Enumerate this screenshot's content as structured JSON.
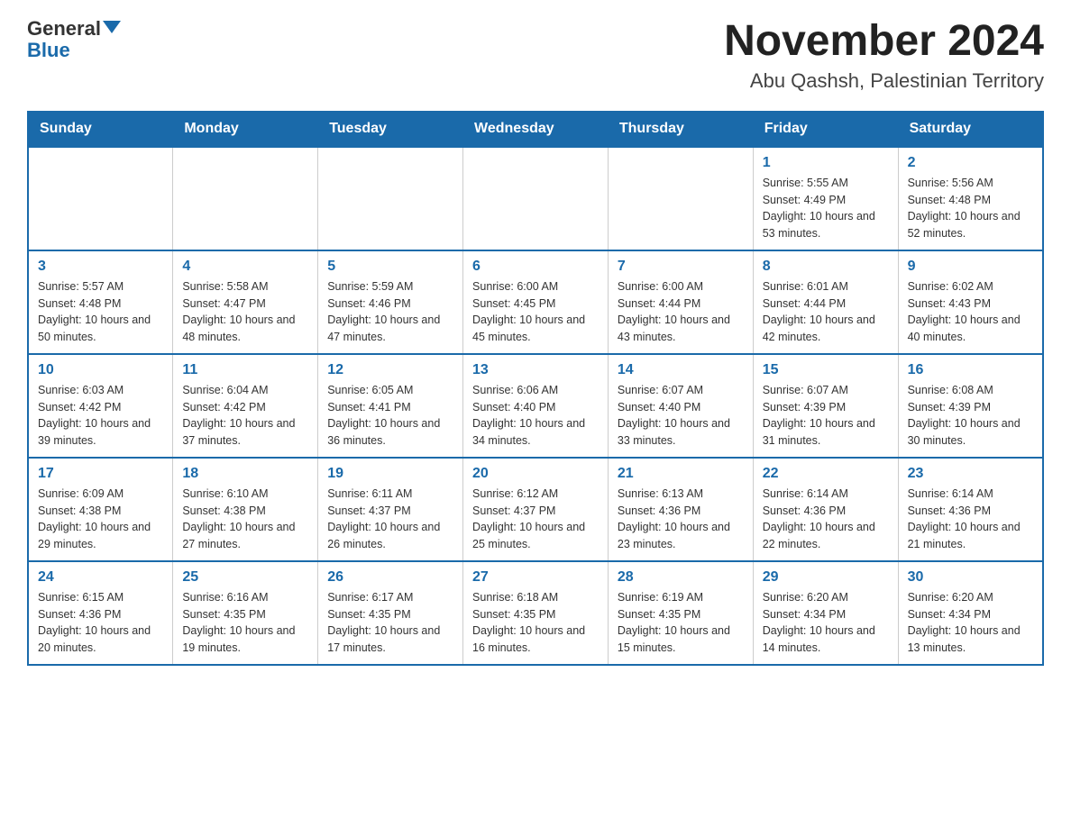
{
  "header": {
    "logo_general": "General",
    "logo_blue": "Blue",
    "title": "November 2024",
    "location": "Abu Qashsh, Palestinian Territory"
  },
  "days_of_week": [
    "Sunday",
    "Monday",
    "Tuesday",
    "Wednesday",
    "Thursday",
    "Friday",
    "Saturday"
  ],
  "weeks": [
    [
      {
        "day": "",
        "sunrise": "",
        "sunset": "",
        "daylight": ""
      },
      {
        "day": "",
        "sunrise": "",
        "sunset": "",
        "daylight": ""
      },
      {
        "day": "",
        "sunrise": "",
        "sunset": "",
        "daylight": ""
      },
      {
        "day": "",
        "sunrise": "",
        "sunset": "",
        "daylight": ""
      },
      {
        "day": "",
        "sunrise": "",
        "sunset": "",
        "daylight": ""
      },
      {
        "day": "1",
        "sunrise": "Sunrise: 5:55 AM",
        "sunset": "Sunset: 4:49 PM",
        "daylight": "Daylight: 10 hours and 53 minutes."
      },
      {
        "day": "2",
        "sunrise": "Sunrise: 5:56 AM",
        "sunset": "Sunset: 4:48 PM",
        "daylight": "Daylight: 10 hours and 52 minutes."
      }
    ],
    [
      {
        "day": "3",
        "sunrise": "Sunrise: 5:57 AM",
        "sunset": "Sunset: 4:48 PM",
        "daylight": "Daylight: 10 hours and 50 minutes."
      },
      {
        "day": "4",
        "sunrise": "Sunrise: 5:58 AM",
        "sunset": "Sunset: 4:47 PM",
        "daylight": "Daylight: 10 hours and 48 minutes."
      },
      {
        "day": "5",
        "sunrise": "Sunrise: 5:59 AM",
        "sunset": "Sunset: 4:46 PM",
        "daylight": "Daylight: 10 hours and 47 minutes."
      },
      {
        "day": "6",
        "sunrise": "Sunrise: 6:00 AM",
        "sunset": "Sunset: 4:45 PM",
        "daylight": "Daylight: 10 hours and 45 minutes."
      },
      {
        "day": "7",
        "sunrise": "Sunrise: 6:00 AM",
        "sunset": "Sunset: 4:44 PM",
        "daylight": "Daylight: 10 hours and 43 minutes."
      },
      {
        "day": "8",
        "sunrise": "Sunrise: 6:01 AM",
        "sunset": "Sunset: 4:44 PM",
        "daylight": "Daylight: 10 hours and 42 minutes."
      },
      {
        "day": "9",
        "sunrise": "Sunrise: 6:02 AM",
        "sunset": "Sunset: 4:43 PM",
        "daylight": "Daylight: 10 hours and 40 minutes."
      }
    ],
    [
      {
        "day": "10",
        "sunrise": "Sunrise: 6:03 AM",
        "sunset": "Sunset: 4:42 PM",
        "daylight": "Daylight: 10 hours and 39 minutes."
      },
      {
        "day": "11",
        "sunrise": "Sunrise: 6:04 AM",
        "sunset": "Sunset: 4:42 PM",
        "daylight": "Daylight: 10 hours and 37 minutes."
      },
      {
        "day": "12",
        "sunrise": "Sunrise: 6:05 AM",
        "sunset": "Sunset: 4:41 PM",
        "daylight": "Daylight: 10 hours and 36 minutes."
      },
      {
        "day": "13",
        "sunrise": "Sunrise: 6:06 AM",
        "sunset": "Sunset: 4:40 PM",
        "daylight": "Daylight: 10 hours and 34 minutes."
      },
      {
        "day": "14",
        "sunrise": "Sunrise: 6:07 AM",
        "sunset": "Sunset: 4:40 PM",
        "daylight": "Daylight: 10 hours and 33 minutes."
      },
      {
        "day": "15",
        "sunrise": "Sunrise: 6:07 AM",
        "sunset": "Sunset: 4:39 PM",
        "daylight": "Daylight: 10 hours and 31 minutes."
      },
      {
        "day": "16",
        "sunrise": "Sunrise: 6:08 AM",
        "sunset": "Sunset: 4:39 PM",
        "daylight": "Daylight: 10 hours and 30 minutes."
      }
    ],
    [
      {
        "day": "17",
        "sunrise": "Sunrise: 6:09 AM",
        "sunset": "Sunset: 4:38 PM",
        "daylight": "Daylight: 10 hours and 29 minutes."
      },
      {
        "day": "18",
        "sunrise": "Sunrise: 6:10 AM",
        "sunset": "Sunset: 4:38 PM",
        "daylight": "Daylight: 10 hours and 27 minutes."
      },
      {
        "day": "19",
        "sunrise": "Sunrise: 6:11 AM",
        "sunset": "Sunset: 4:37 PM",
        "daylight": "Daylight: 10 hours and 26 minutes."
      },
      {
        "day": "20",
        "sunrise": "Sunrise: 6:12 AM",
        "sunset": "Sunset: 4:37 PM",
        "daylight": "Daylight: 10 hours and 25 minutes."
      },
      {
        "day": "21",
        "sunrise": "Sunrise: 6:13 AM",
        "sunset": "Sunset: 4:36 PM",
        "daylight": "Daylight: 10 hours and 23 minutes."
      },
      {
        "day": "22",
        "sunrise": "Sunrise: 6:14 AM",
        "sunset": "Sunset: 4:36 PM",
        "daylight": "Daylight: 10 hours and 22 minutes."
      },
      {
        "day": "23",
        "sunrise": "Sunrise: 6:14 AM",
        "sunset": "Sunset: 4:36 PM",
        "daylight": "Daylight: 10 hours and 21 minutes."
      }
    ],
    [
      {
        "day": "24",
        "sunrise": "Sunrise: 6:15 AM",
        "sunset": "Sunset: 4:36 PM",
        "daylight": "Daylight: 10 hours and 20 minutes."
      },
      {
        "day": "25",
        "sunrise": "Sunrise: 6:16 AM",
        "sunset": "Sunset: 4:35 PM",
        "daylight": "Daylight: 10 hours and 19 minutes."
      },
      {
        "day": "26",
        "sunrise": "Sunrise: 6:17 AM",
        "sunset": "Sunset: 4:35 PM",
        "daylight": "Daylight: 10 hours and 17 minutes."
      },
      {
        "day": "27",
        "sunrise": "Sunrise: 6:18 AM",
        "sunset": "Sunset: 4:35 PM",
        "daylight": "Daylight: 10 hours and 16 minutes."
      },
      {
        "day": "28",
        "sunrise": "Sunrise: 6:19 AM",
        "sunset": "Sunset: 4:35 PM",
        "daylight": "Daylight: 10 hours and 15 minutes."
      },
      {
        "day": "29",
        "sunrise": "Sunrise: 6:20 AM",
        "sunset": "Sunset: 4:34 PM",
        "daylight": "Daylight: 10 hours and 14 minutes."
      },
      {
        "day": "30",
        "sunrise": "Sunrise: 6:20 AM",
        "sunset": "Sunset: 4:34 PM",
        "daylight": "Daylight: 10 hours and 13 minutes."
      }
    ]
  ],
  "colors": {
    "header_bg": "#1a6aaa",
    "header_text": "#ffffff",
    "day_number": "#1a6aaa",
    "border": "#cccccc",
    "accent_border": "#1a6aaa"
  }
}
